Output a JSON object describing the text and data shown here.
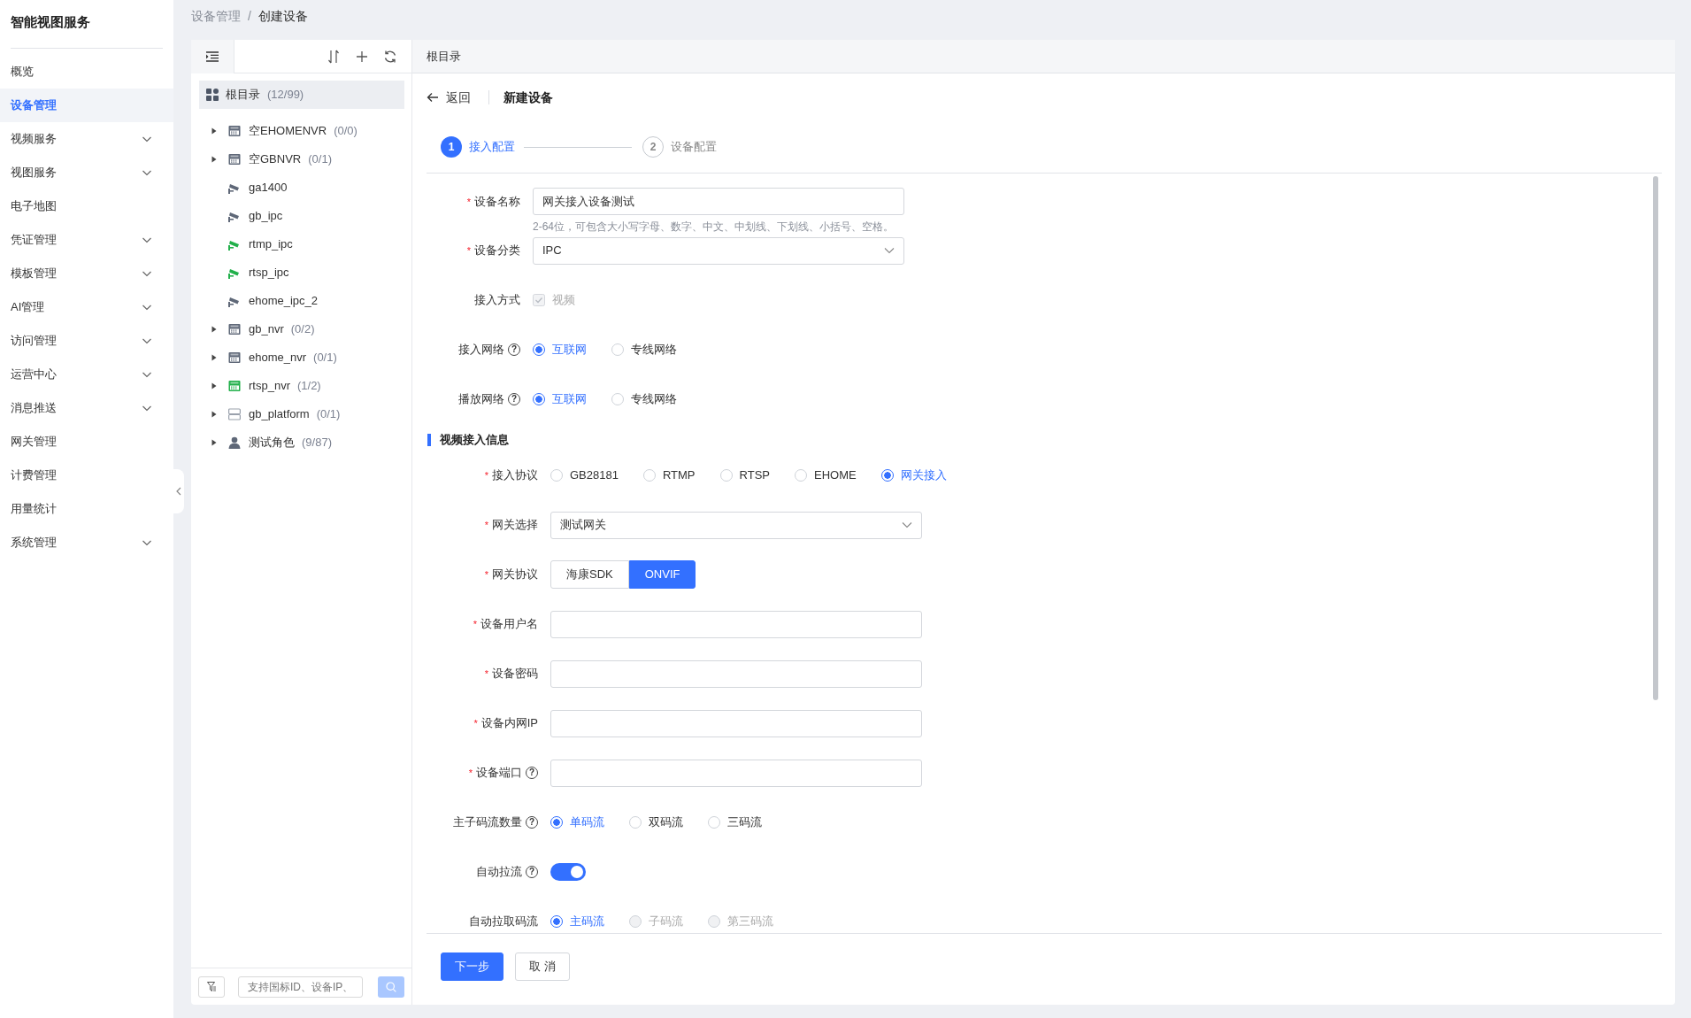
{
  "app": {
    "title": "智能视图服务"
  },
  "sidebar": {
    "items": [
      {
        "label": "概览",
        "selected": false,
        "expandable": false
      },
      {
        "label": "设备管理",
        "selected": true,
        "expandable": false
      },
      {
        "label": "视频服务",
        "selected": false,
        "expandable": true
      },
      {
        "label": "视图服务",
        "selected": false,
        "expandable": true
      },
      {
        "label": "电子地图",
        "selected": false,
        "expandable": false
      },
      {
        "label": "凭证管理",
        "selected": false,
        "expandable": true
      },
      {
        "label": "模板管理",
        "selected": false,
        "expandable": true
      },
      {
        "label": "AI管理",
        "selected": false,
        "expandable": true
      },
      {
        "label": "访问管理",
        "selected": false,
        "expandable": true
      },
      {
        "label": "运营中心",
        "selected": false,
        "expandable": true
      },
      {
        "label": "消息推送",
        "selected": false,
        "expandable": true
      },
      {
        "label": "网关管理",
        "selected": false,
        "expandable": false
      },
      {
        "label": "计费管理",
        "selected": false,
        "expandable": false
      },
      {
        "label": "用量统计",
        "selected": false,
        "expandable": false
      },
      {
        "label": "系统管理",
        "selected": false,
        "expandable": true
      }
    ]
  },
  "breadcrumb": {
    "items": [
      "设备管理",
      "创建设备"
    ],
    "separator": "/"
  },
  "tree": {
    "root": {
      "label": "根目录",
      "count": "(12/99)",
      "selected": true
    },
    "items": [
      {
        "kind": "nvr",
        "label": "空EHOMENVR",
        "count": "(0/0)",
        "online": false,
        "expandable": true
      },
      {
        "kind": "nvr",
        "label": "空GBNVR",
        "count": "(0/1)",
        "online": false,
        "expandable": true
      },
      {
        "kind": "ipc",
        "label": "ga1400",
        "online": false,
        "expandable": false
      },
      {
        "kind": "ipc",
        "label": "gb_ipc",
        "online": false,
        "expandable": false
      },
      {
        "kind": "ipc",
        "label": "rtmp_ipc",
        "online": true,
        "expandable": false
      },
      {
        "kind": "ipc",
        "label": "rtsp_ipc",
        "online": true,
        "expandable": false
      },
      {
        "kind": "ipc",
        "label": "ehome_ipc_2",
        "online": false,
        "expandable": false
      },
      {
        "kind": "nvr",
        "label": "gb_nvr",
        "count": "(0/2)",
        "online": false,
        "expandable": true
      },
      {
        "kind": "nvr",
        "label": "ehome_nvr",
        "count": "(0/1)",
        "online": false,
        "expandable": true
      },
      {
        "kind": "nvr",
        "label": "rtsp_nvr",
        "count": "(1/2)",
        "online": true,
        "expandable": true
      },
      {
        "kind": "platform",
        "label": "gb_platform",
        "count": "(0/1)",
        "expandable": true
      },
      {
        "kind": "role",
        "label": "测试角色",
        "count": "(9/87)",
        "online": false,
        "expandable": true
      }
    ],
    "search": {
      "placeholder": "支持国标ID、设备IP、",
      "disabled": true
    }
  },
  "content": {
    "path": "根目录",
    "back": "返回",
    "title": "新建设备",
    "steps": [
      {
        "number": "1",
        "label": "接入配置",
        "selected": true
      },
      {
        "number": "2",
        "label": "设备配置",
        "selected": false
      }
    ],
    "fields": [
      {
        "kind": "text",
        "required_mark": "*",
        "label": "设备名称",
        "value": "网关接入设备测试",
        "hint": "2-64位，可包含大小写字母、数字、中文、中划线、下划线、小括号、空格。"
      },
      {
        "kind": "select",
        "required_mark": "*",
        "label": "设备分类",
        "value": "IPC"
      },
      {
        "kind": "checkbox",
        "label": "接入方式",
        "options": [
          {
            "label": "视频",
            "checked": true,
            "disabled": true
          }
        ]
      },
      {
        "kind": "radio",
        "label": "接入网络",
        "help": "?",
        "options": [
          {
            "label": "互联网",
            "selected": true
          },
          {
            "label": "专线网络",
            "selected": false
          }
        ]
      },
      {
        "kind": "radio",
        "label": "播放网络",
        "help": "?",
        "options": [
          {
            "label": "互联网",
            "selected": true
          },
          {
            "label": "专线网络",
            "selected": false
          }
        ]
      }
    ],
    "section": {
      "title": "视频接入信息",
      "fields": [
        {
          "kind": "radio",
          "required_mark": "*",
          "label": "接入协议",
          "options": [
            {
              "label": "GB28181",
              "selected": false
            },
            {
              "label": "RTMP",
              "selected": false
            },
            {
              "label": "RTSP",
              "selected": false
            },
            {
              "label": "EHOME",
              "selected": false
            },
            {
              "label": "网关接入",
              "selected": true
            }
          ]
        },
        {
          "kind": "select",
          "required_mark": "*",
          "label": "网关选择",
          "value": "测试网关"
        },
        {
          "kind": "segmented",
          "required_mark": "*",
          "label": "网关协议",
          "options": [
            {
              "label": "海康SDK",
              "selected": false
            },
            {
              "label": "ONVIF",
              "selected": true
            }
          ]
        },
        {
          "kind": "text",
          "required_mark": "*",
          "label": "设备用户名"
        },
        {
          "kind": "text",
          "required_mark": "*",
          "label": "设备密码"
        },
        {
          "kind": "text",
          "required_mark": "*",
          "label": "设备内网IP"
        },
        {
          "kind": "text",
          "required_mark": "*",
          "label": "设备端口",
          "help": "?"
        },
        {
          "kind": "radio",
          "label": "主子码流数量",
          "help": "?",
          "options": [
            {
              "label": "单码流",
              "selected": true
            },
            {
              "label": "双码流",
              "selected": false
            },
            {
              "label": "三码流",
              "selected": false
            }
          ]
        },
        {
          "kind": "switch",
          "label": "自动拉流",
          "help": "?",
          "on": true
        },
        {
          "kind": "radio",
          "label": "自动拉取码流",
          "options": [
            {
              "label": "主码流",
              "selected": true
            },
            {
              "label": "子码流",
              "selected": false,
              "disabled": true
            },
            {
              "label": "第三码流",
              "selected": false,
              "disabled": true
            }
          ]
        }
      ]
    },
    "buttons": [
      {
        "label": "下一步",
        "kind": "primary"
      },
      {
        "label": "取 消",
        "kind": "default"
      }
    ]
  }
}
